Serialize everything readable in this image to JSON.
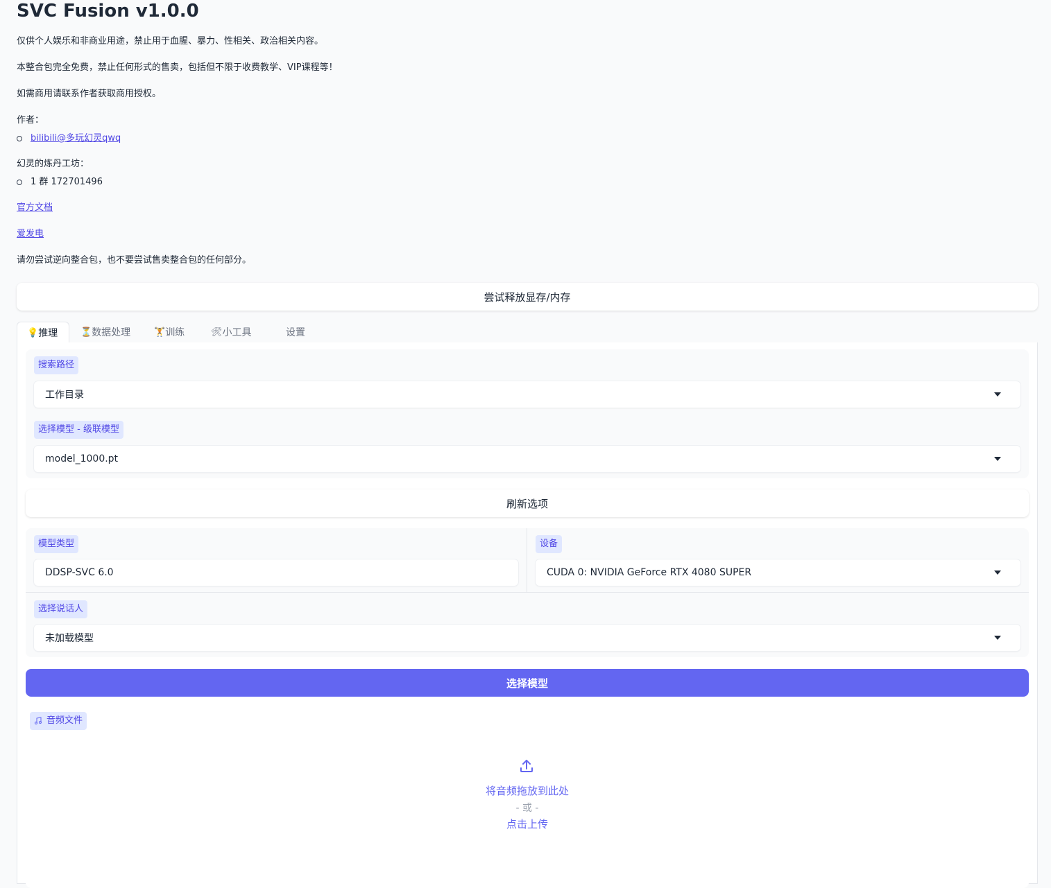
{
  "header": {
    "title": "SVC Fusion v1.0.0",
    "p1": "仅供个人娱乐和非商业用途，禁止用于血腥、暴力、性相关、政治相关内容。",
    "p2": "本整合包完全免费，禁止任何形式的售卖，包括但不限于收费教学、VIP课程等！",
    "p3": "如需商用请联系作者获取商用授权。",
    "author_label": "作者：",
    "author_link": "bilibili@多玩幻灵qwq",
    "group_label": "幻灵的炼丹工坊：",
    "group_item": "1 群 172701496",
    "docs_link": "官方文档",
    "donate_link": "爱发电",
    "warning": "请勿尝试逆向整合包，也不要尝试售卖整合包的任何部分。"
  },
  "free_memory_button": "尝试释放显存/内存",
  "tabs": [
    {
      "icon": "💡",
      "label": "推理"
    },
    {
      "icon": "⏳",
      "label": "数据处理"
    },
    {
      "icon": "🏋",
      "label": "训练"
    },
    {
      "icon": "🛠",
      "label": "小工具"
    },
    {
      "icon": "",
      "label": "设置"
    }
  ],
  "search_path": {
    "label": "搜索路径",
    "value": "工作目录"
  },
  "select_model": {
    "label": "选择模型 - 级联模型",
    "value": "model_1000.pt"
  },
  "refresh_button": "刷新选项",
  "model_type": {
    "label": "模型类型",
    "value": "DDSP-SVC 6.0"
  },
  "device": {
    "label": "设备",
    "value": "CUDA 0: NVIDIA GeForce RTX 4080 SUPER"
  },
  "speaker": {
    "label": "选择说话人",
    "value": "未加载模型"
  },
  "choose_model_button": "选择模型",
  "audio": {
    "label": "音频文件",
    "drop_text": "将音频拖放到此处",
    "or_text": "- 或 -",
    "click_text": "点击上传"
  }
}
